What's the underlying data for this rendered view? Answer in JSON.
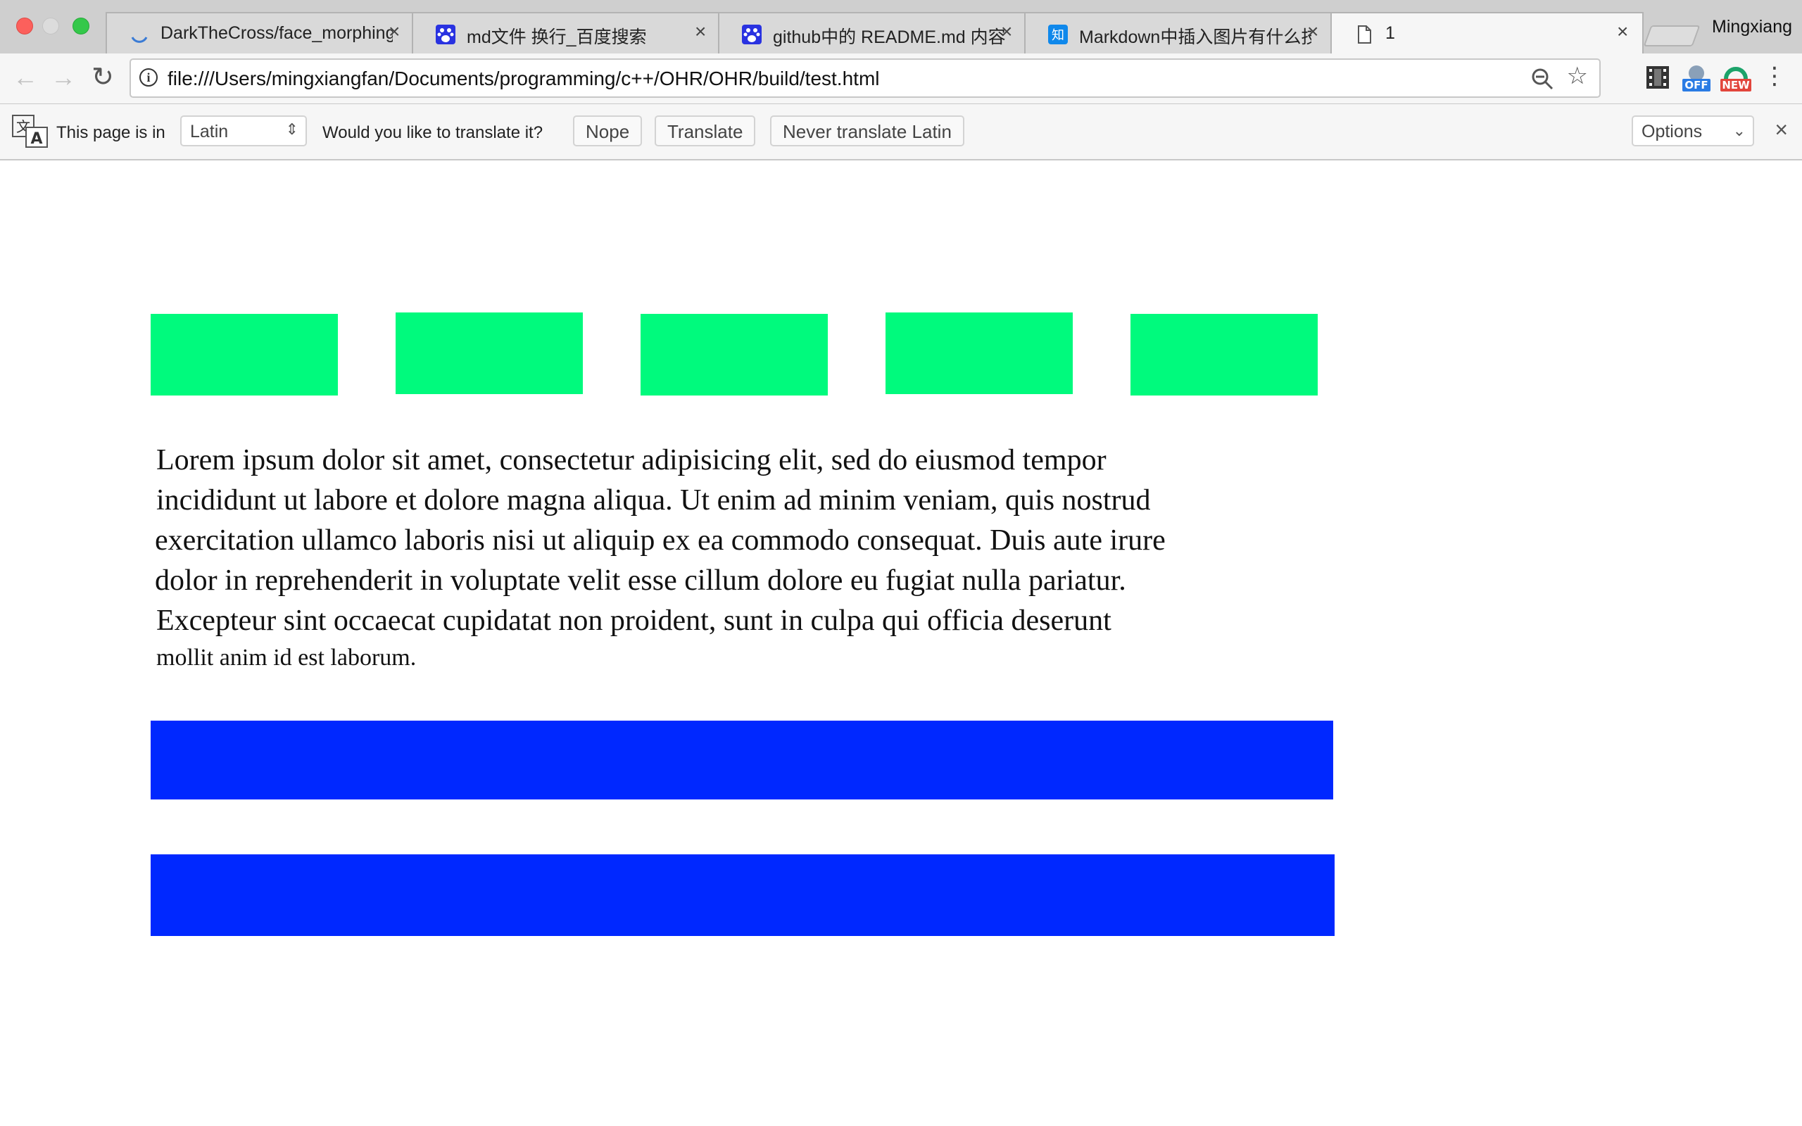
{
  "browser": {
    "tabs": [
      {
        "title": "DarkTheCross/face_morphing",
        "favicon": "loading-spinner-icon",
        "close": "×"
      },
      {
        "title": "md文件 换行_百度搜索",
        "favicon": "baidu-paw-icon",
        "close": "×"
      },
      {
        "title": "github中的 README.md 内容",
        "favicon": "baidu-paw-icon",
        "close": "×"
      },
      {
        "title": "Markdown中插入图片有什么技",
        "favicon": "zhihu-icon",
        "close": "×"
      },
      {
        "title": "1",
        "favicon": "page-icon",
        "close": "×"
      }
    ],
    "profile_name": "Mingxiang",
    "url": "file:///Users/mingxiangfan/Documents/programming/c++/OHR/OHR/build/test.html",
    "extensions": [
      {
        "name": "film-strip-icon"
      },
      {
        "name": "off-badge-icon",
        "badge": "OFF"
      },
      {
        "name": "new-badge-icon",
        "badge": "NEW"
      }
    ]
  },
  "translate_bar": {
    "page_is_in": "This page is in",
    "language": "Latin",
    "question": "Would you like to translate it?",
    "nope": "Nope",
    "translate": "Translate",
    "never": "Never translate Latin",
    "options": "Options",
    "close": "×"
  },
  "content": {
    "lorem_lines": [
      "Lorem ipsum dolor sit amet, consectetur adipisicing elit, sed do eiusmod tempor",
      "incididunt ut labore et dolore magna aliqua. Ut enim ad minim veniam, quis nostrud",
      "exercitation ullamco laboris nisi ut aliquip ex ea commodo consequat. Duis aute irure",
      "dolor in reprehenderit in voluptate velit esse cillum dolore eu fugiat nulla pariatur.",
      "Excepteur sint occaecat cupidatat non proident, sunt in culpa qui officia deserunt",
      "mollit anim id est laborum."
    ],
    "green_color": "#00fa7d",
    "blue_color": "#0028ff"
  }
}
